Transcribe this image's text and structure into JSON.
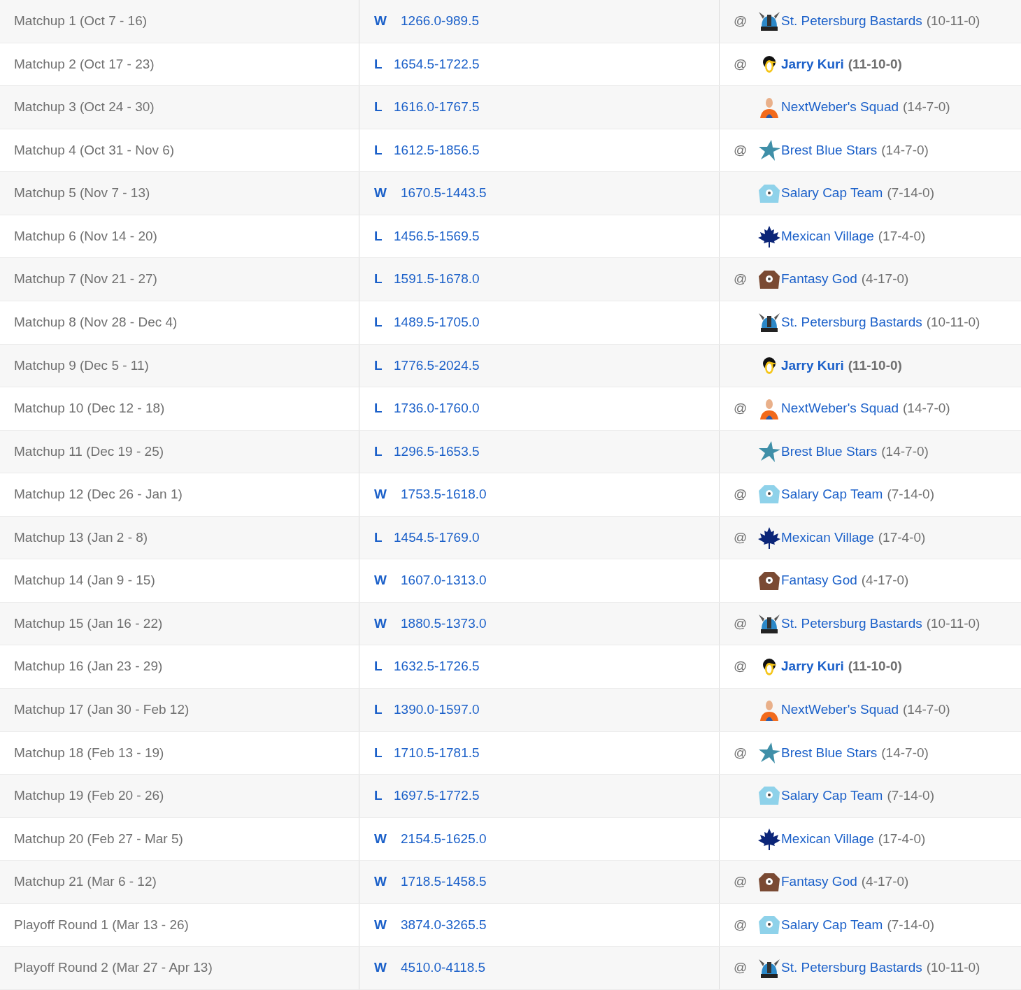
{
  "rows": [
    {
      "period": "Matchup 1 (Oct 7 - 16)",
      "result": "W",
      "score": "1266.0-989.5",
      "away": true,
      "logo": {
        "kind": "viking"
      },
      "opponent": "St. Petersburg Bastards",
      "record": "(10-11-0)",
      "bold": false
    },
    {
      "period": "Matchup 2 (Oct 17 - 23)",
      "result": "L",
      "score": "1654.5-1722.5",
      "away": true,
      "logo": {
        "kind": "penguin"
      },
      "opponent": "Jarry Kuri",
      "record": "(11-10-0)",
      "bold": true
    },
    {
      "period": "Matchup 3 (Oct 24 - 30)",
      "result": "L",
      "score": "1616.0-1767.5",
      "away": false,
      "logo": {
        "kind": "person"
      },
      "opponent": "NextWeber's Squad",
      "record": "(14-7-0)",
      "bold": false
    },
    {
      "period": "Matchup 4 (Oct 31 - Nov 6)",
      "result": "L",
      "score": "1612.5-1856.5",
      "away": true,
      "logo": {
        "kind": "star"
      },
      "opponent": "Brest Blue Stars",
      "record": "(14-7-0)",
      "bold": false
    },
    {
      "period": "Matchup 5 (Nov 7 - 13)",
      "result": "W",
      "score": "1670.5-1443.5",
      "away": false,
      "logo": {
        "kind": "jersey-blue"
      },
      "opponent": "Salary Cap Team",
      "record": "(7-14-0)",
      "bold": false
    },
    {
      "period": "Matchup 6 (Nov 14 - 20)",
      "result": "L",
      "score": "1456.5-1569.5",
      "away": false,
      "logo": {
        "kind": "leaf"
      },
      "opponent": "Mexican Village",
      "record": "(17-4-0)",
      "bold": false
    },
    {
      "period": "Matchup 7 (Nov 21 - 27)",
      "result": "L",
      "score": "1591.5-1678.0",
      "away": true,
      "logo": {
        "kind": "jersey-brown"
      },
      "opponent": "Fantasy God",
      "record": "(4-17-0)",
      "bold": false
    },
    {
      "period": "Matchup 8 (Nov 28 - Dec 4)",
      "result": "L",
      "score": "1489.5-1705.0",
      "away": false,
      "logo": {
        "kind": "viking"
      },
      "opponent": "St. Petersburg Bastards",
      "record": "(10-11-0)",
      "bold": false
    },
    {
      "period": "Matchup 9 (Dec 5 - 11)",
      "result": "L",
      "score": "1776.5-2024.5",
      "away": false,
      "logo": {
        "kind": "penguin"
      },
      "opponent": "Jarry Kuri",
      "record": "(11-10-0)",
      "bold": true
    },
    {
      "period": "Matchup 10 (Dec 12 - 18)",
      "result": "L",
      "score": "1736.0-1760.0",
      "away": true,
      "logo": {
        "kind": "person"
      },
      "opponent": "NextWeber's Squad",
      "record": "(14-7-0)",
      "bold": false
    },
    {
      "period": "Matchup 11 (Dec 19 - 25)",
      "result": "L",
      "score": "1296.5-1653.5",
      "away": false,
      "logo": {
        "kind": "star"
      },
      "opponent": "Brest Blue Stars",
      "record": "(14-7-0)",
      "bold": false
    },
    {
      "period": "Matchup 12 (Dec 26 - Jan 1)",
      "result": "W",
      "score": "1753.5-1618.0",
      "away": true,
      "logo": {
        "kind": "jersey-blue"
      },
      "opponent": "Salary Cap Team",
      "record": "(7-14-0)",
      "bold": false
    },
    {
      "period": "Matchup 13 (Jan 2 - 8)",
      "result": "L",
      "score": "1454.5-1769.0",
      "away": true,
      "logo": {
        "kind": "leaf"
      },
      "opponent": "Mexican Village",
      "record": "(17-4-0)",
      "bold": false
    },
    {
      "period": "Matchup 14 (Jan 9 - 15)",
      "result": "W",
      "score": "1607.0-1313.0",
      "away": false,
      "logo": {
        "kind": "jersey-brown"
      },
      "opponent": "Fantasy God",
      "record": "(4-17-0)",
      "bold": false
    },
    {
      "period": "Matchup 15 (Jan 16 - 22)",
      "result": "W",
      "score": "1880.5-1373.0",
      "away": true,
      "logo": {
        "kind": "viking"
      },
      "opponent": "St. Petersburg Bastards",
      "record": "(10-11-0)",
      "bold": false
    },
    {
      "period": "Matchup 16 (Jan 23 - 29)",
      "result": "L",
      "score": "1632.5-1726.5",
      "away": true,
      "logo": {
        "kind": "penguin"
      },
      "opponent": "Jarry Kuri",
      "record": "(11-10-0)",
      "bold": true
    },
    {
      "period": "Matchup 17 (Jan 30 - Feb 12)",
      "result": "L",
      "score": "1390.0-1597.0",
      "away": false,
      "logo": {
        "kind": "person"
      },
      "opponent": "NextWeber's Squad",
      "record": "(14-7-0)",
      "bold": false
    },
    {
      "period": "Matchup 18 (Feb 13 - 19)",
      "result": "L",
      "score": "1710.5-1781.5",
      "away": true,
      "logo": {
        "kind": "star"
      },
      "opponent": "Brest Blue Stars",
      "record": "(14-7-0)",
      "bold": false
    },
    {
      "period": "Matchup 19 (Feb 20 - 26)",
      "result": "L",
      "score": "1697.5-1772.5",
      "away": false,
      "logo": {
        "kind": "jersey-blue"
      },
      "opponent": "Salary Cap Team",
      "record": "(7-14-0)",
      "bold": false
    },
    {
      "period": "Matchup 20 (Feb 27 - Mar 5)",
      "result": "W",
      "score": "2154.5-1625.0",
      "away": false,
      "logo": {
        "kind": "leaf"
      },
      "opponent": "Mexican Village",
      "record": "(17-4-0)",
      "bold": false
    },
    {
      "period": "Matchup 21 (Mar 6 - 12)",
      "result": "W",
      "score": "1718.5-1458.5",
      "away": true,
      "logo": {
        "kind": "jersey-brown"
      },
      "opponent": "Fantasy God",
      "record": "(4-17-0)",
      "bold": false
    },
    {
      "period": "Playoff Round 1 (Mar 13 - 26)",
      "result": "W",
      "score": "3874.0-3265.5",
      "away": true,
      "logo": {
        "kind": "jersey-blue"
      },
      "opponent": "Salary Cap Team",
      "record": "(7-14-0)",
      "bold": false
    },
    {
      "period": "Playoff Round 2 (Mar 27 - Apr 13)",
      "result": "W",
      "score": "4510.0-4118.5",
      "away": true,
      "logo": {
        "kind": "viking"
      },
      "opponent": "St. Petersburg Bastards",
      "record": "(10-11-0)",
      "bold": false
    }
  ],
  "away_marker": "@"
}
